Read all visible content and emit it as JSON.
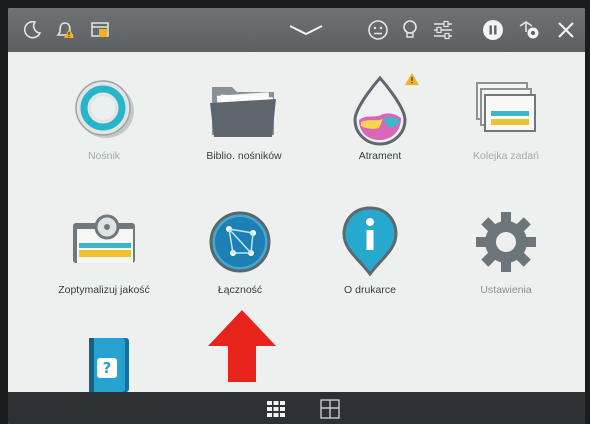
{
  "topbar": {
    "icons": [
      "moon-sleep-icon",
      "warning-bell-icon",
      "job-queue-icon",
      "chevron-down-icon",
      "smiley-icon",
      "lightbulb-icon",
      "sliders-icon",
      "pause-icon",
      "network-settings-icon",
      "close-icon"
    ]
  },
  "apps": [
    {
      "label": "Nośnik",
      "icon": "media-roll-icon",
      "state": "disabled"
    },
    {
      "label": "Biblio. nośników",
      "icon": "folder-library-icon",
      "state": "enabled"
    },
    {
      "label": "Atrament",
      "icon": "ink-drop-icon",
      "state": "enabled",
      "warning": true
    },
    {
      "label": "Kolejka zadań",
      "icon": "job-queue-stack-icon",
      "state": "disabled"
    },
    {
      "label": "Zoptymalizuj jakość",
      "icon": "optimize-quality-icon",
      "state": "enabled"
    },
    {
      "label": "Łączność",
      "icon": "globe-connectivity-icon",
      "state": "enabled"
    },
    {
      "label": "O drukarce",
      "icon": "info-pin-icon",
      "state": "enabled"
    },
    {
      "label": "Ustawienia",
      "icon": "gear-icon",
      "state": "enabled"
    },
    {
      "label": "",
      "icon": "help-book-icon",
      "state": "enabled"
    }
  ],
  "bottombar": {
    "icons": [
      "grid-view-icon",
      "window-view-icon"
    ]
  },
  "annotation": {
    "icon": "red-arrow-up-icon",
    "color": "#e8231b"
  }
}
